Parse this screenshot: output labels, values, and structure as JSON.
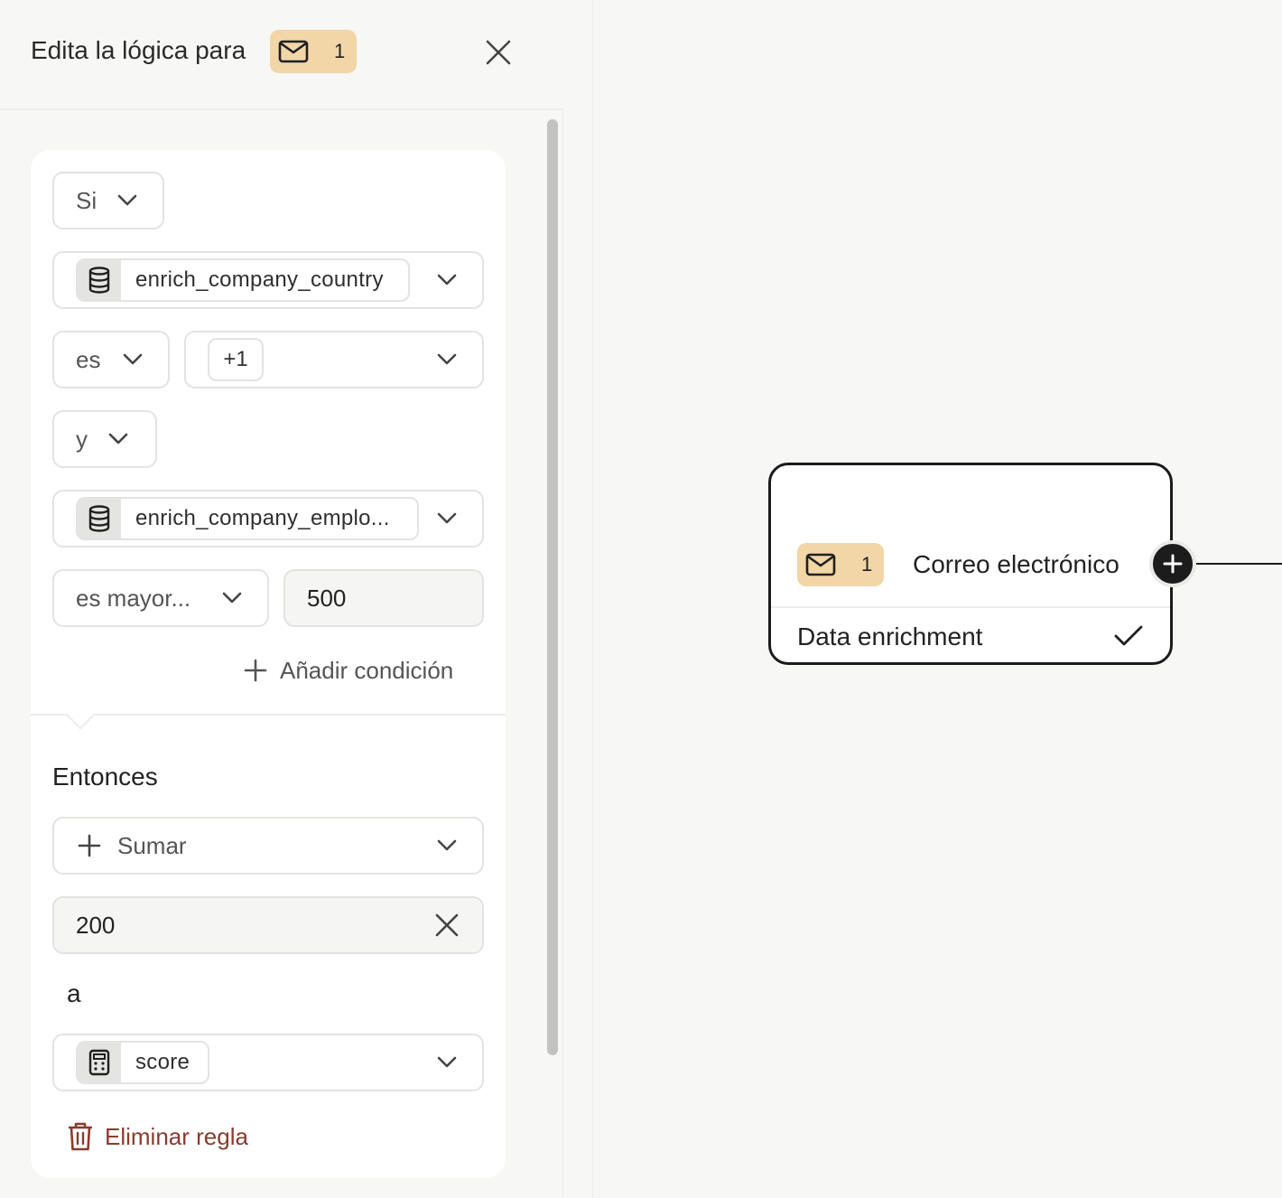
{
  "panel": {
    "title": "Edita la lógica para",
    "step_badge": {
      "icon": "envelope-icon",
      "number": "1"
    },
    "close_icon": "close-icon"
  },
  "rule": {
    "if_select": "Si",
    "condition1": {
      "field_icon": "database-icon",
      "field": "enrich_company_country",
      "operator": "es",
      "value_chip": "+1"
    },
    "connector": "y",
    "condition2": {
      "field_icon": "database-icon",
      "field": "enrich_company_emplo...",
      "operator": "es mayor...",
      "value": "500"
    },
    "add_condition": "Añadir condición",
    "then_label": "Entonces",
    "action": {
      "icon": "plus-icon",
      "label": "Sumar"
    },
    "amount": "200",
    "to_label": "a",
    "target": {
      "icon": "calculator-icon",
      "field": "score"
    },
    "delete_rule": "Eliminar regla"
  },
  "canvas": {
    "node": {
      "badge_number": "1",
      "title": "Correo electrónico",
      "status": "Data enrichment",
      "status_icon": "check-icon",
      "add_icon": "plus-icon"
    }
  },
  "colors": {
    "badge_bg": "#f2d6a8",
    "danger": "#8a3b2d",
    "node_border": "#1b1b1b",
    "background": "#f7f7f5"
  }
}
